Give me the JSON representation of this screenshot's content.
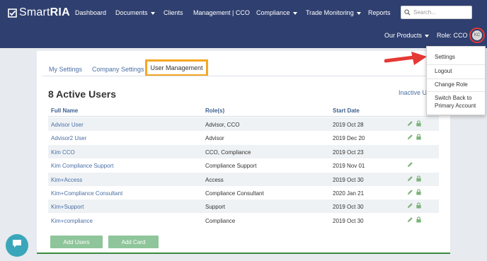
{
  "app": {
    "name_light": "Smart",
    "name_bold": "RIA"
  },
  "nav": {
    "items": [
      {
        "label": "Dashboard"
      },
      {
        "label": "Documents"
      },
      {
        "label": "Clients"
      },
      {
        "label": "Management | CCO"
      },
      {
        "label": "Compliance"
      },
      {
        "label": "Trade Monitoring"
      },
      {
        "label": "Reports"
      }
    ],
    "search_placeholder": "Search...",
    "our_products": "Our Products",
    "role": "Role: CCO",
    "avatar_initials": "KC"
  },
  "dropdown": {
    "items": [
      {
        "label": "Settings"
      },
      {
        "label": "Logout"
      },
      {
        "label": "Change Role"
      },
      {
        "label": "Switch Back to Primary Account"
      }
    ]
  },
  "tabs": [
    {
      "label": "My Settings"
    },
    {
      "label": "Company Settings"
    },
    {
      "label": "User Management"
    }
  ],
  "heading": "8 Active Users",
  "inactive_link": "Inactive Users",
  "table": {
    "headers": [
      "Full Name",
      "Role(s)",
      "Start Date"
    ],
    "rows": [
      {
        "name": "Advisor User",
        "role": "Advisor, CCO",
        "date": "2019 Oct 28"
      },
      {
        "name": "Advisor2 User",
        "role": "Advisor",
        "date": "2019 Dec 20"
      },
      {
        "name": "Kim CCO",
        "role": "CCO, Compliance",
        "date": "2019 Oct 23"
      },
      {
        "name": "Kim Compliance Support",
        "role": "Compliance Support",
        "date": "2019 Nov 01"
      },
      {
        "name": "Kim+Access",
        "role": "Access",
        "date": "2019 Oct 30"
      },
      {
        "name": "Kim+Compliance Consultant",
        "role": "Compliance Consultant",
        "date": "2020 Jan 21"
      },
      {
        "name": "Kim+Support",
        "role": "Support",
        "date": "2019 Oct 30"
      },
      {
        "name": "Kim+compliance",
        "role": "Compliance",
        "date": "2019 Oct 30"
      }
    ]
  },
  "buttons": {
    "add_users": "Add Users",
    "add_card": "Add Card"
  },
  "colors": {
    "navbar": "#2f3f6f",
    "highlight_box": "#f5a623",
    "annotation_red": "#e53935",
    "button_green": "#8fc59a",
    "link_blue": "#4a6fa5",
    "chat_teal": "#3aa6b9"
  }
}
